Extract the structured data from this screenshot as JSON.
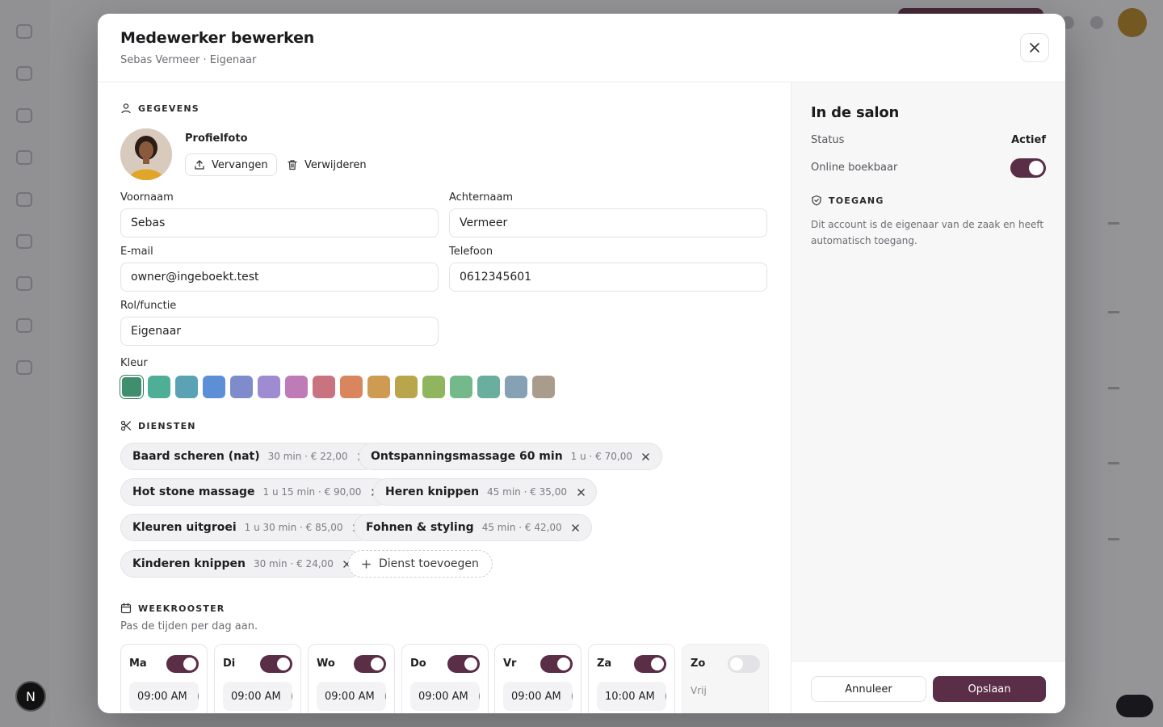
{
  "background": {
    "logo_letter": "N"
  },
  "modal": {
    "title": "Medewerker bewerken",
    "subtitle": "Sebas Vermeer · Eigenaar"
  },
  "gegevens": {
    "section_title": "GEGEVENS",
    "profile_photo_label": "Profielfoto",
    "replace_label": "Vervangen",
    "delete_label": "Verwijderen",
    "fields": {
      "voornaam": {
        "label": "Voornaam",
        "value": "Sebas"
      },
      "achternaam": {
        "label": "Achternaam",
        "value": "Vermeer"
      },
      "email": {
        "label": "E-mail",
        "value": "owner@ingeboekt.test"
      },
      "telefoon": {
        "label": "Telefoon",
        "value": "0612345601"
      },
      "rol": {
        "label": "Rol/functie",
        "value": "Eigenaar"
      }
    },
    "color_label": "Kleur",
    "colors": [
      "#3f8f6f",
      "#4fae96",
      "#5aa2b4",
      "#5c8fd6",
      "#7f8ccb",
      "#9e8bd1",
      "#be7bb8",
      "#c97380",
      "#d9865e",
      "#cf9a52",
      "#b8a54c",
      "#8fb55e",
      "#74b98a",
      "#6aae9e",
      "#86a1b3",
      "#a99c8c"
    ],
    "selected_color": "#3f8f6f"
  },
  "diensten": {
    "section_title": "DIENSTEN",
    "items": [
      {
        "name": "Baard scheren (nat)",
        "meta": "30 min · € 22,00"
      },
      {
        "name": "Ontspanningsmassage 60 min",
        "meta": "1 u · € 70,00"
      },
      {
        "name": "Hot stone massage",
        "meta": "1 u 15 min · € 90,00"
      },
      {
        "name": "Heren knippen",
        "meta": "45 min · € 35,00"
      },
      {
        "name": "Kleuren uitgroei",
        "meta": "1 u 30 min · € 85,00"
      },
      {
        "name": "Fohnen & styling",
        "meta": "45 min · € 42,00"
      },
      {
        "name": "Kinderen knippen",
        "meta": "30 min · € 24,00"
      }
    ],
    "add_label": "Dienst toevoegen"
  },
  "weekrooster": {
    "section_title": "WEEKROOSTER",
    "subtitle": "Pas de tijden per dag aan.",
    "days": [
      {
        "name": "Ma",
        "enabled": true,
        "start": "09:00 AM"
      },
      {
        "name": "Di",
        "enabled": true,
        "start": "09:00 AM"
      },
      {
        "name": "Wo",
        "enabled": true,
        "start": "09:00 AM"
      },
      {
        "name": "Do",
        "enabled": true,
        "start": "09:00 AM"
      },
      {
        "name": "Vr",
        "enabled": true,
        "start": "09:00 AM"
      },
      {
        "name": "Za",
        "enabled": true,
        "start": "10:00 AM"
      },
      {
        "name": "Zo",
        "enabled": false,
        "off_label": "Vrij"
      }
    ]
  },
  "salon": {
    "title": "In de salon",
    "status_label": "Status",
    "status_value": "Actief",
    "online_label": "Online boekbaar",
    "online_enabled": true,
    "access_title": "TOEGANG",
    "access_text": "Dit account is de eigenaar van de zaak en heeft automatisch toegang."
  },
  "footer": {
    "cancel_label": "Annuleer",
    "save_label": "Opslaan"
  },
  "accent": "#5b2e48"
}
